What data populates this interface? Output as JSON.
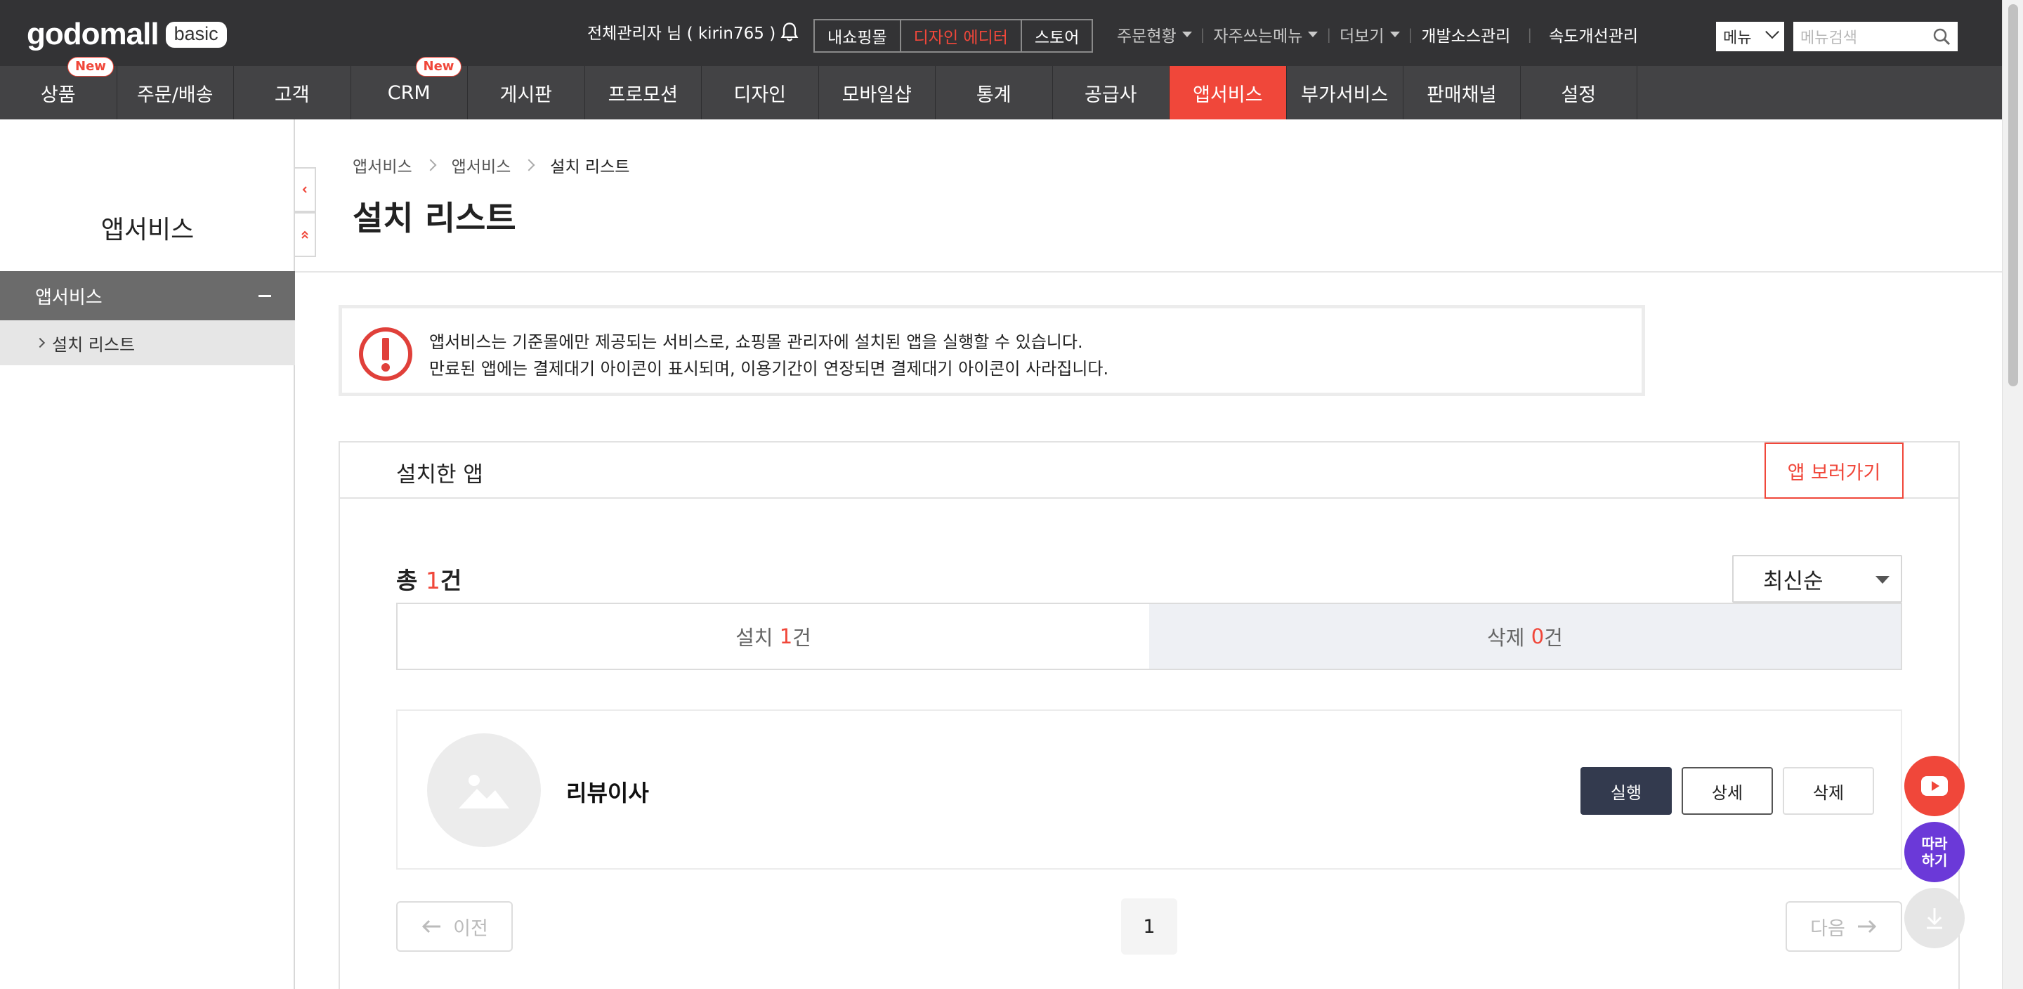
{
  "header": {
    "logo": "godomall",
    "logo_badge": "basic",
    "admin_user": "전체관리자 님 ( kirin765 )",
    "top_buttons": [
      "내쇼핑몰",
      "디자인 에디터",
      "스토어"
    ],
    "links": {
      "order_status": "주문현황",
      "favorites": "자주쓰는메뉴",
      "more": "더보기",
      "dev_source": "개발소스관리",
      "speed": "속도개선관리"
    },
    "menu_select": "메뉴",
    "menu_search_placeholder": "메뉴검색"
  },
  "gnb": {
    "new_badge": "New",
    "items": [
      "상품",
      "주문/배송",
      "고객",
      "CRM",
      "게시판",
      "프로모션",
      "디자인",
      "모바일샵",
      "통계",
      "공급사",
      "앱서비스",
      "부가서비스",
      "판매채널",
      "설정"
    ],
    "active": "앱서비스"
  },
  "sidebar": {
    "title": "앱서비스",
    "group": "앱서비스",
    "item": "설치 리스트"
  },
  "breadcrumb": [
    "앱서비스",
    "앱서비스",
    "설치 리스트"
  ],
  "page_title": "설치 리스트",
  "notice": {
    "line1": "앱서비스는 기준몰에만 제공되는 서비스로, 쇼핑몰 관리자에 설치된 앱을 실행할 수 있습니다.",
    "line2": "만료된 앱에는 결제대기 아이콘이 표시되며, 이용기간이 연장되면 결제대기 아이콘이 사라집니다."
  },
  "panel": {
    "title": "설치한 앱",
    "browse_button": "앱 보러가기",
    "total_prefix": "총 ",
    "total_count": "1",
    "total_suffix": "건",
    "sort": "최신순",
    "tabs": {
      "installed_prefix": "설치 ",
      "installed_count": "1",
      "installed_suffix": "건",
      "deleted_prefix": "삭제 ",
      "deleted_count": "0",
      "deleted_suffix": "건"
    },
    "app": {
      "name": "리뷰이사",
      "run": "실행",
      "detail": "상세",
      "delete": "삭제"
    },
    "pager": {
      "prev": "이전",
      "page": "1",
      "next": "다음"
    }
  },
  "floating": {
    "follow_line1": "따라",
    "follow_line2": "하기"
  },
  "colors": {
    "accent": "#f0473a",
    "topbar": "#333335",
    "gnb": "#434345",
    "run_button": "#333a4e",
    "follow_button": "#6b39d8"
  }
}
